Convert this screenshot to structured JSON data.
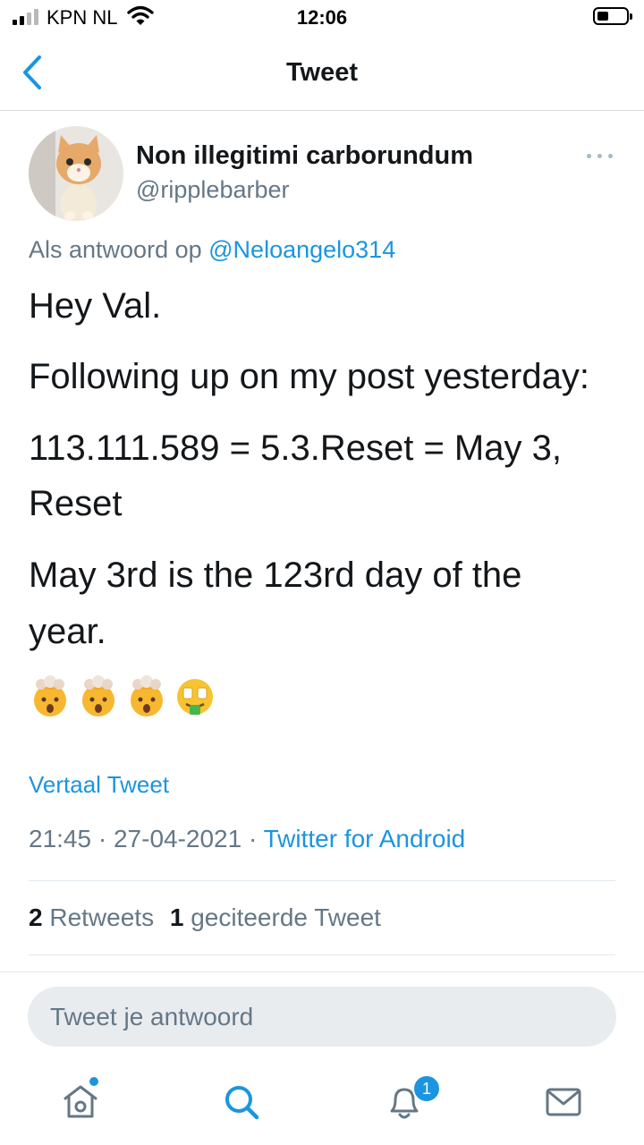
{
  "status_bar": {
    "carrier": "KPN NL",
    "time": "12:06"
  },
  "nav": {
    "title": "Tweet",
    "back_icon": "chevron-left-icon"
  },
  "tweet": {
    "author_name": "Non illegitimi carborundum",
    "author_handle": "@ripplebarber",
    "reply_prefix": "Als antwoord op",
    "reply_mention": "@Neloangelo314",
    "lines": [
      "Hey Val.",
      "Following up on my post yesterday:",
      "113.111.589 = 5.3.Reset = May 3,",
      "Reset",
      "May 3rd is the 123rd day of the",
      "year."
    ],
    "emojis": [
      "🤯",
      "🤯",
      "🤯",
      "🤑"
    ],
    "translate_label": "Vertaal Tweet",
    "time": "21:45",
    "date": "27-04-2021",
    "source": "Twitter for Android",
    "retweets_count": "2",
    "retweets_label": "Retweets",
    "quotes_count": "1",
    "quotes_label": "geciteerde Tweet"
  },
  "reply_input": {
    "placeholder": "Tweet je antwoord"
  },
  "tab_bar": {
    "items": [
      "home-icon",
      "search-icon",
      "notifications-icon",
      "messages-icon"
    ],
    "notifications_badge": "1"
  },
  "colors": {
    "accent": "#1b95e0",
    "secondary_text": "#657786",
    "primary_text": "#14171a"
  }
}
